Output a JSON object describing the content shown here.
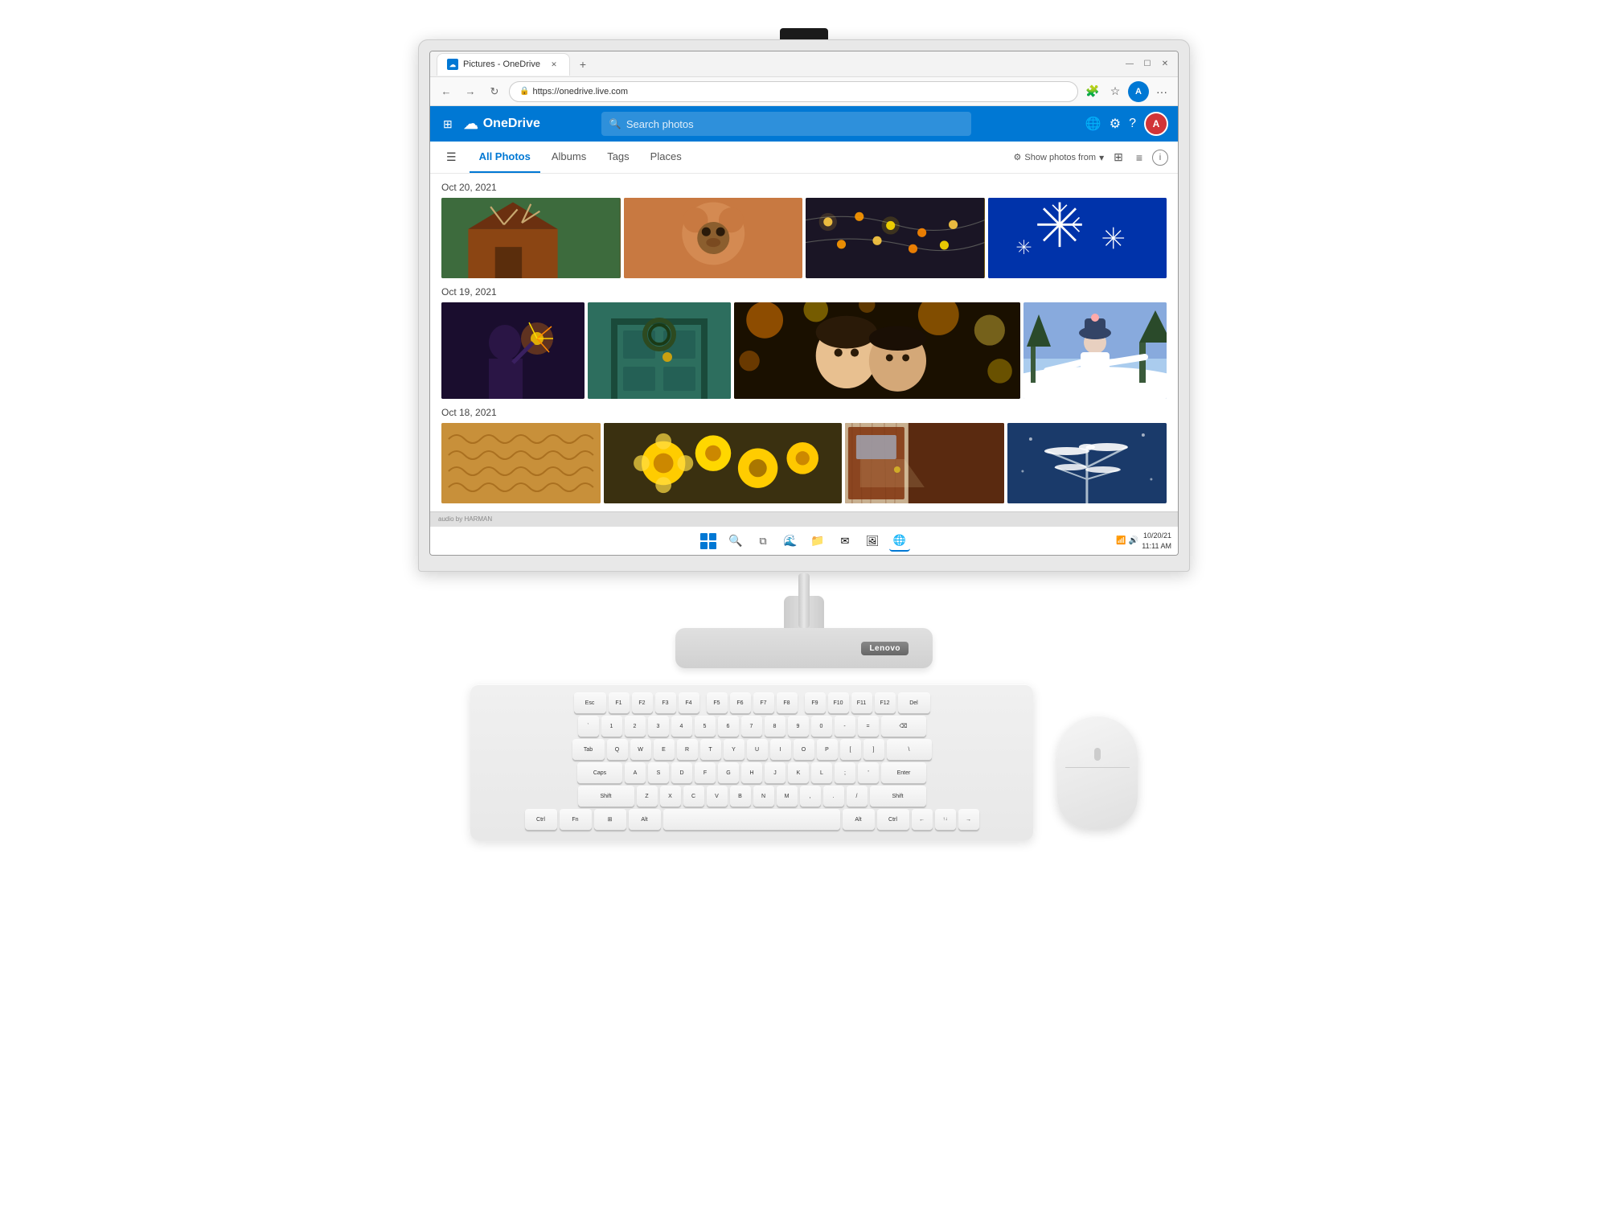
{
  "browser": {
    "tab_title": "Pictures - OneDrive",
    "tab_favicon": "☁",
    "url": "https://onedrive.live.com",
    "window_controls": {
      "minimize": "—",
      "maximize": "☐",
      "close": "✕"
    }
  },
  "onedrive": {
    "app_name": "OneDrive",
    "search_placeholder": "Search photos",
    "actions": {
      "globe": "🌐",
      "settings": "⚙",
      "help": "?",
      "profile_initial": "A"
    }
  },
  "nav": {
    "tabs": [
      {
        "label": "All Photos",
        "active": true
      },
      {
        "label": "Albums",
        "active": false
      },
      {
        "label": "Tags",
        "active": false
      },
      {
        "label": "Places",
        "active": false
      }
    ],
    "show_photos_from": "Show photos from",
    "info": "i"
  },
  "photos": {
    "groups": [
      {
        "date": "Oct 20, 2021",
        "photos": [
          {
            "alt": "Barn with antlers"
          },
          {
            "alt": "Child in bear costume"
          },
          {
            "alt": "String lights"
          },
          {
            "alt": "Sparkle fireworks"
          }
        ]
      },
      {
        "date": "Oct 19, 2021",
        "photos": [
          {
            "alt": "Person with sparkler"
          },
          {
            "alt": "Teal door"
          },
          {
            "alt": "Bokeh children portrait"
          },
          {
            "alt": "Woman in snow winter joy"
          }
        ]
      },
      {
        "date": "Oct 18, 2021",
        "photos": [
          {
            "alt": "Knitted fabric"
          },
          {
            "alt": "Yellow flowers"
          },
          {
            "alt": "Wooden door interior"
          },
          {
            "alt": "Snow branches blue"
          }
        ]
      }
    ]
  },
  "taskbar": {
    "clock": "10/20/21\n11:11 AM",
    "icons": [
      "start",
      "search",
      "taskview",
      "edge",
      "file",
      "mail",
      "chromium",
      "browser"
    ]
  },
  "monitor": {
    "harman_label": "audio by HARMAN",
    "lenovo_badge": "Lenovo"
  },
  "keys_row1": [
    "Esc",
    "F1",
    "F2",
    "F3",
    "F4",
    "F5",
    "F6",
    "F7",
    "F8",
    "F9",
    "F10",
    "F11",
    "F12",
    "Del"
  ],
  "keys_row2": [
    "`",
    "1",
    "2",
    "3",
    "4",
    "5",
    "6",
    "7",
    "8",
    "9",
    "0",
    "-",
    "=",
    "⌫"
  ],
  "keys_row3": [
    "Tab",
    "Q",
    "W",
    "E",
    "R",
    "T",
    "Y",
    "U",
    "I",
    "O",
    "P",
    "[",
    "]",
    "\\"
  ],
  "keys_row4": [
    "Caps",
    "A",
    "S",
    "D",
    "F",
    "G",
    "H",
    "J",
    "K",
    "L",
    ";",
    "'",
    "Enter"
  ],
  "keys_row5": [
    "Shift",
    "Z",
    "X",
    "C",
    "V",
    "B",
    "N",
    "M",
    ",",
    ".",
    "/",
    "Shift"
  ],
  "keys_row6": [
    "Ctrl",
    "Fn",
    "Win",
    "Alt",
    "Space",
    "Alt",
    "Ctrl",
    "←",
    "↑↓",
    "→"
  ]
}
